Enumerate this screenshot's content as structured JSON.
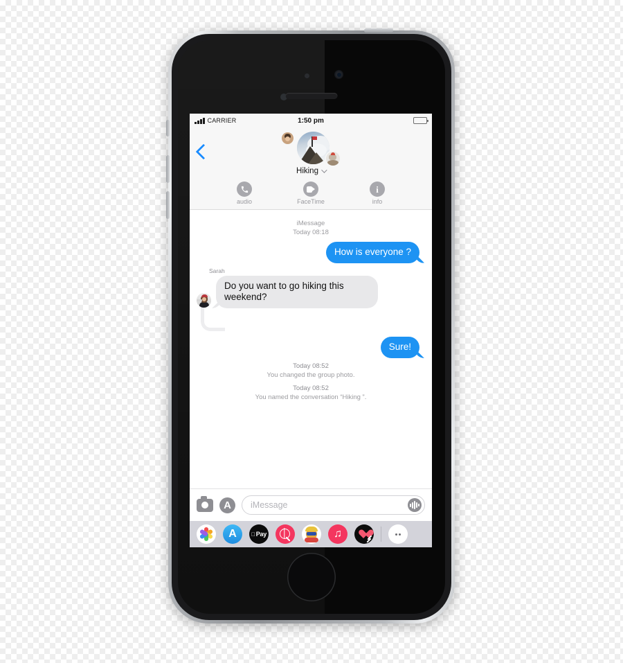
{
  "device": {
    "name": "iPhone",
    "frame_color": "#b9bcc0"
  },
  "status_bar": {
    "carrier": "CARRIER",
    "time": "1:50 pm",
    "signal_icon": "signal-bars-icon",
    "battery_icon": "battery-full-icon"
  },
  "nav": {
    "back_icon": "chevron-left-icon",
    "group_title": "Hiking",
    "disclosure_icon": "chevron-down-icon",
    "avatar_main": "group-photo-mountain",
    "avatar_left": "member-avatar-1",
    "avatar_right": "member-avatar-2"
  },
  "actions": [
    {
      "label": "audio",
      "icon": "phone-icon"
    },
    {
      "label": "FaceTime",
      "icon": "video-camera-icon"
    },
    {
      "label": "info",
      "icon": "info-icon"
    }
  ],
  "conversation": {
    "service_label": "iMessage",
    "first_timestamp": "Today 08:18",
    "messages": [
      {
        "kind": "outgoing",
        "text": "How is everyone ?"
      },
      {
        "kind": "incoming",
        "sender": "Sarah",
        "text": "Do you want to go hiking this weekend?"
      },
      {
        "kind": "outgoing",
        "text": "Sure!"
      }
    ],
    "system_events": [
      {
        "timestamp": "Today 08:52",
        "text": "You changed the group photo."
      },
      {
        "timestamp": "Today 08:52",
        "text": "You named the conversation “Hiking ”."
      }
    ]
  },
  "composer": {
    "camera_icon": "camera-icon",
    "appstore_icon": "app-store-icon",
    "placeholder": "iMessage",
    "value": "",
    "mic_icon": "audio-waveform-icon"
  },
  "app_drawer": {
    "apps": [
      {
        "name": "photos-app-icon",
        "label": "Photos"
      },
      {
        "name": "app-store-app-icon",
        "label": "App Store"
      },
      {
        "name": "apple-pay-app-icon",
        "label": "Pay"
      },
      {
        "name": "images-app-icon",
        "label": "#images"
      },
      {
        "name": "memoji-app-icon",
        "label": "Memoji Stickers"
      },
      {
        "name": "music-app-icon",
        "label": "Music"
      },
      {
        "name": "digital-touch-app-icon",
        "label": "Digital Touch"
      }
    ],
    "more_icon": "more-apps-icon",
    "apple_pay_text": "Pay",
    "app_store_glyph": "A",
    "music_glyph": "♫"
  },
  "colors": {
    "imessage_blue": "#1d93f3",
    "incoming_gray": "#e8e8ea",
    "tint_blue": "#1a8cff",
    "drawer_bg": "#d3d3da",
    "chrome_bg": "#f7f7f7"
  }
}
